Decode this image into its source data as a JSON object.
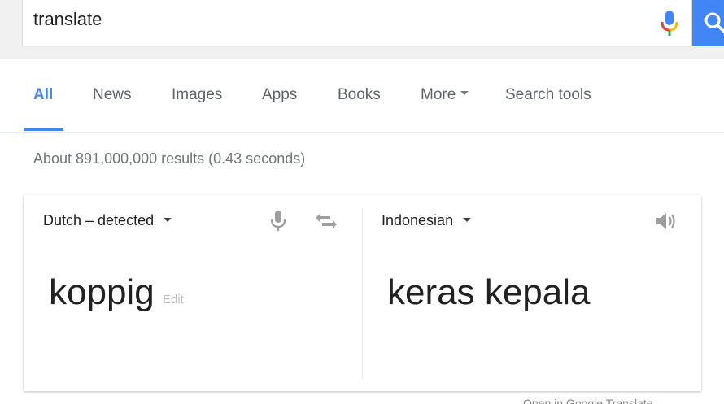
{
  "search": {
    "query": "translate"
  },
  "tabs": [
    {
      "label": "All"
    },
    {
      "label": "News"
    },
    {
      "label": "Images"
    },
    {
      "label": "Apps"
    },
    {
      "label": "Books"
    },
    {
      "label": "More"
    },
    {
      "label": "Search tools"
    }
  ],
  "result_stats": "About 891,000,000 results (0.43 seconds)",
  "translator": {
    "source_language": "Dutch – detected",
    "target_language": "Indonesian",
    "source_text": "koppig",
    "edit_label": "Edit",
    "translated_text": "keras kepala"
  },
  "footer": {
    "link_text": "Open in Google Translate"
  },
  "colors": {
    "accent": "#4285f4",
    "mic_red": "#ea4335",
    "mic_yellow": "#fbbc05",
    "mic_green": "#34a853"
  },
  "icons": [
    "microphone-icon",
    "search-icon",
    "dropdown-caret-icon",
    "swap-languages-icon",
    "speaker-icon"
  ]
}
